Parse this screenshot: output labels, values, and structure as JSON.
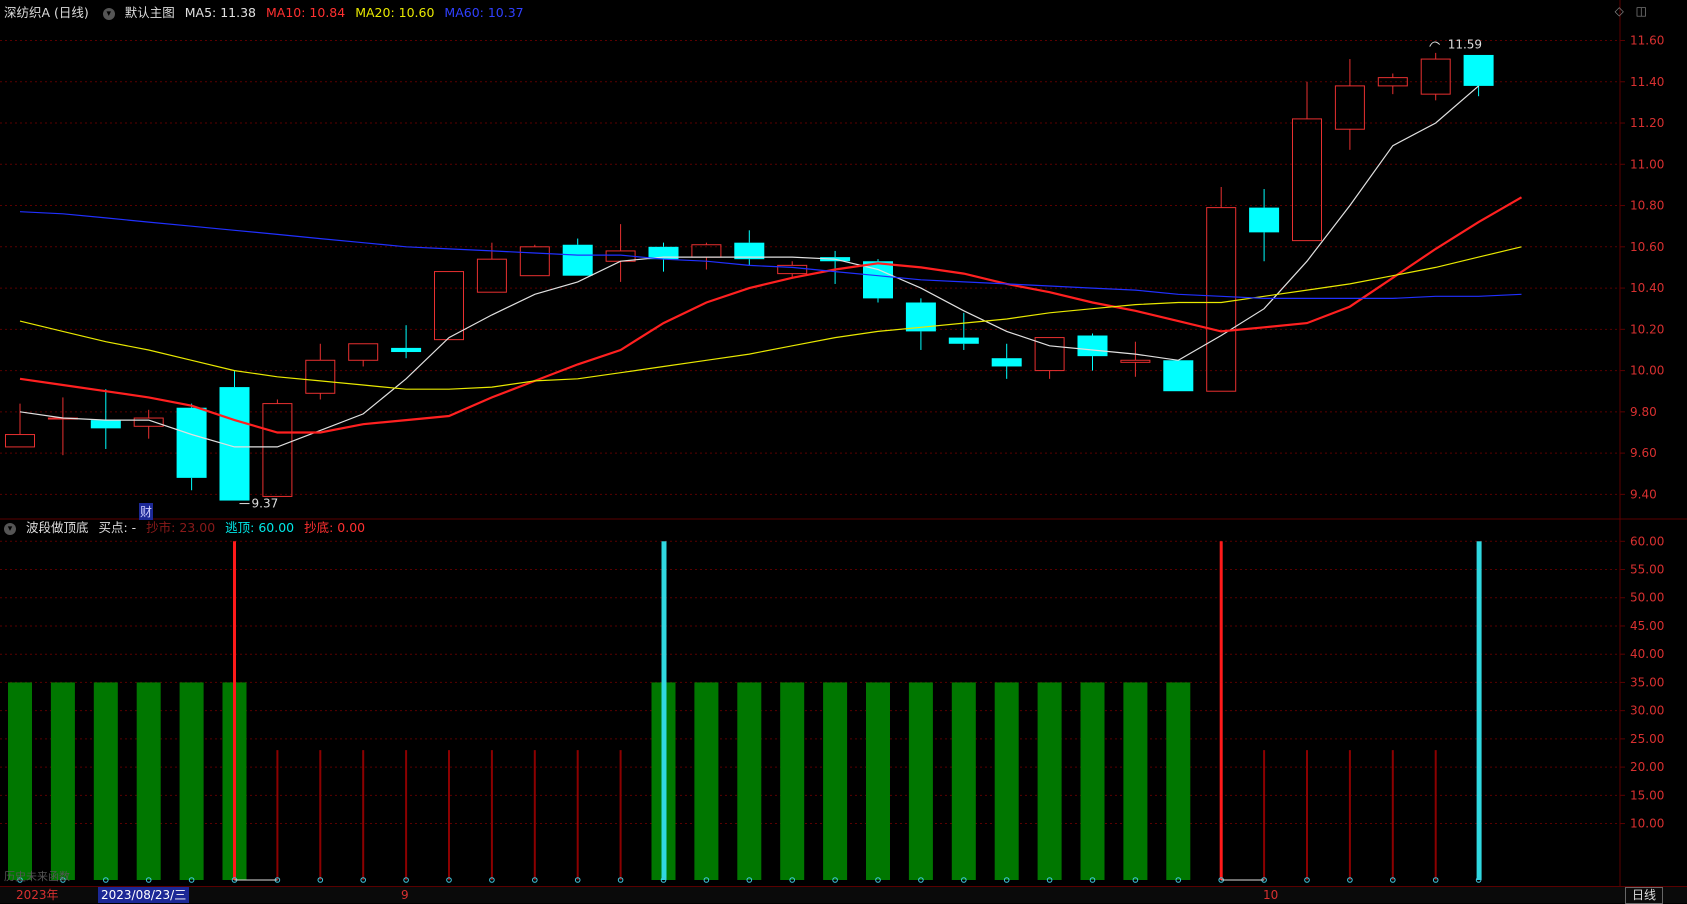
{
  "header": {
    "stock_title": "深纺织A (日线)",
    "main_chart_label": "默认主图",
    "ma5": "MA5: 11.38",
    "ma10": "MA10: 10.84",
    "ma20": "MA20: 10.60",
    "ma60": "MA60: 10.37"
  },
  "indicator_header": {
    "name": "波段做顶底",
    "buy_point": "买点: -",
    "escape_top": "逃顶: 60.00",
    "bottom_fish": "抄底: 0.00",
    "dimmed_item": "抄市: 23.00"
  },
  "colors": {
    "up": "#e83030",
    "down": "#00ffff",
    "ma5": "#e0e0e0",
    "ma10": "#ff2020",
    "ma20": "#e8e800",
    "ma60": "#2030ff",
    "grid": "#5a0000",
    "green_bar": "#007700"
  },
  "annotations": {
    "high_label": "11.59",
    "low_label": "9.37",
    "finance_marker": "财"
  },
  "bottom_bar": {
    "year": "2023年",
    "date": "2023/08/23/三",
    "month_9": "9",
    "month_10": "10",
    "period_button": "日线"
  },
  "watermark": "历史未来函数",
  "chart_data": [
    {
      "type": "candlestick",
      "ylim": [
        9.3,
        11.68
      ],
      "y_ticks": [
        "11.60",
        "11.40",
        "11.20",
        "11.00",
        "10.80",
        "10.60",
        "10.40",
        "10.20",
        "10.00",
        "9.80",
        "9.60",
        "9.40"
      ],
      "candles": [
        {
          "o": 9.63,
          "h": 9.84,
          "l": 9.63,
          "c": 9.69
        },
        {
          "o": 9.77,
          "h": 9.87,
          "l": 9.59,
          "c": 9.77
        },
        {
          "o": 9.76,
          "h": 9.91,
          "l": 9.62,
          "c": 9.72
        },
        {
          "o": 9.73,
          "h": 9.81,
          "l": 9.67,
          "c": 9.77
        },
        {
          "o": 9.82,
          "h": 9.84,
          "l": 9.42,
          "c": 9.48
        },
        {
          "o": 9.92,
          "h": 10.0,
          "l": 9.37,
          "c": 9.37
        },
        {
          "o": 9.39,
          "h": 9.86,
          "l": 9.39,
          "c": 9.84
        },
        {
          "o": 9.89,
          "h": 10.13,
          "l": 9.86,
          "c": 10.05
        },
        {
          "o": 10.05,
          "h": 10.13,
          "l": 10.02,
          "c": 10.13
        },
        {
          "o": 10.11,
          "h": 10.22,
          "l": 10.06,
          "c": 10.09
        },
        {
          "o": 10.15,
          "h": 10.48,
          "l": 10.15,
          "c": 10.48
        },
        {
          "o": 10.38,
          "h": 10.62,
          "l": 10.38,
          "c": 10.54
        },
        {
          "o": 10.46,
          "h": 10.61,
          "l": 10.46,
          "c": 10.6
        },
        {
          "o": 10.61,
          "h": 10.64,
          "l": 10.46,
          "c": 10.46
        },
        {
          "o": 10.53,
          "h": 10.71,
          "l": 10.43,
          "c": 10.58
        },
        {
          "o": 10.6,
          "h": 10.62,
          "l": 10.48,
          "c": 10.54
        },
        {
          "o": 10.55,
          "h": 10.62,
          "l": 10.49,
          "c": 10.61
        },
        {
          "o": 10.62,
          "h": 10.68,
          "l": 10.51,
          "c": 10.54
        },
        {
          "o": 10.47,
          "h": 10.53,
          "l": 10.45,
          "c": 10.51
        },
        {
          "o": 10.55,
          "h": 10.58,
          "l": 10.42,
          "c": 10.53
        },
        {
          "o": 10.53,
          "h": 10.54,
          "l": 10.33,
          "c": 10.35
        },
        {
          "o": 10.33,
          "h": 10.35,
          "l": 10.1,
          "c": 10.19
        },
        {
          "o": 10.16,
          "h": 10.28,
          "l": 10.1,
          "c": 10.13
        },
        {
          "o": 10.06,
          "h": 10.13,
          "l": 9.96,
          "c": 10.02
        },
        {
          "o": 10.0,
          "h": 10.16,
          "l": 9.96,
          "c": 10.16
        },
        {
          "o": 10.17,
          "h": 10.18,
          "l": 10.0,
          "c": 10.07
        },
        {
          "o": 10.04,
          "h": 10.14,
          "l": 9.97,
          "c": 10.05
        },
        {
          "o": 10.05,
          "h": 10.05,
          "l": 9.9,
          "c": 9.9
        },
        {
          "o": 9.9,
          "h": 10.89,
          "l": 9.9,
          "c": 10.79
        },
        {
          "o": 10.79,
          "h": 10.88,
          "l": 10.53,
          "c": 10.67
        },
        {
          "o": 10.63,
          "h": 11.4,
          "l": 10.63,
          "c": 11.22
        },
        {
          "o": 11.17,
          "h": 11.51,
          "l": 11.07,
          "c": 11.38
        },
        {
          "o": 11.38,
          "h": 11.44,
          "l": 11.34,
          "c": 11.42
        },
        {
          "o": 11.34,
          "h": 11.54,
          "l": 11.31,
          "c": 11.51
        },
        {
          "o": 11.53,
          "h": 11.53,
          "l": 11.33,
          "c": 11.38
        }
      ],
      "ma_lines": [
        {
          "name": "MA5",
          "values": [
            9.8,
            9.77,
            9.76,
            9.76,
            9.69,
            9.63,
            9.63,
            9.71,
            9.79,
            9.96,
            10.16,
            10.27,
            10.37,
            10.43,
            10.53,
            10.55,
            10.55,
            10.55,
            10.55,
            10.54,
            10.49,
            10.4,
            10.29,
            10.19,
            10.12,
            10.1,
            10.08,
            10.05,
            10.17,
            10.3,
            10.53,
            10.8,
            11.09,
            11.2,
            11.38
          ]
        },
        {
          "name": "MA10",
          "values": [
            9.96,
            9.93,
            9.9,
            9.87,
            9.83,
            9.76,
            9.7,
            9.7,
            9.74,
            9.76,
            9.78,
            9.87,
            9.95,
            10.03,
            10.1,
            10.23,
            10.33,
            10.4,
            10.45,
            10.49,
            10.52,
            10.5,
            10.47,
            10.42,
            10.38,
            10.33,
            10.29,
            10.24,
            10.19,
            10.21,
            10.23,
            10.31,
            10.45,
            10.59,
            10.72,
            10.84
          ]
        },
        {
          "name": "MA20",
          "values": [
            10.24,
            10.19,
            10.14,
            10.1,
            10.05,
            10.0,
            9.97,
            9.95,
            9.93,
            9.91,
            9.91,
            9.92,
            9.95,
            9.96,
            9.99,
            10.02,
            10.05,
            10.08,
            10.12,
            10.16,
            10.19,
            10.21,
            10.23,
            10.25,
            10.28,
            10.3,
            10.32,
            10.33,
            10.33,
            10.36,
            10.39,
            10.42,
            10.46,
            10.5,
            10.55,
            10.6
          ]
        },
        {
          "name": "MA60",
          "values": [
            10.77,
            10.76,
            10.74,
            10.72,
            10.7,
            10.68,
            10.66,
            10.64,
            10.62,
            10.6,
            10.59,
            10.58,
            10.57,
            10.56,
            10.56,
            10.54,
            10.53,
            10.51,
            10.5,
            10.48,
            10.46,
            10.44,
            10.43,
            10.42,
            10.41,
            10.4,
            10.39,
            10.37,
            10.36,
            10.35,
            10.35,
            10.35,
            10.35,
            10.36,
            10.36,
            10.37
          ]
        }
      ]
    },
    {
      "type": "bar",
      "ylim": [
        0,
        62
      ],
      "y_ticks": [
        "60.00",
        "55.00",
        "50.00",
        "45.00",
        "40.00",
        "35.00",
        "30.00",
        "25.00",
        "20.00",
        "15.00",
        "10.00"
      ],
      "green_values": [
        35,
        35,
        35,
        35,
        35,
        35,
        0,
        0,
        0,
        0,
        0,
        0,
        0,
        0,
        0,
        35,
        35,
        35,
        35,
        35,
        35,
        35,
        35,
        35,
        35,
        35,
        35,
        35,
        0,
        0,
        0,
        0,
        0,
        0,
        0
      ],
      "red_values": [
        0,
        0,
        0,
        0,
        0,
        60,
        23,
        23,
        23,
        23,
        23,
        23,
        23,
        23,
        23,
        0,
        0,
        0,
        0,
        0,
        0,
        0,
        0,
        0,
        0,
        0,
        0,
        0,
        60,
        23,
        23,
        23,
        23,
        23,
        23
      ],
      "cyan_values": [
        0,
        0,
        0,
        0,
        0,
        0,
        0,
        0,
        0,
        0,
        0,
        0,
        0,
        0,
        0,
        60,
        0,
        0,
        0,
        0,
        0,
        0,
        0,
        0,
        0,
        0,
        0,
        0,
        0,
        0,
        0,
        0,
        0,
        0,
        60
      ]
    }
  ]
}
